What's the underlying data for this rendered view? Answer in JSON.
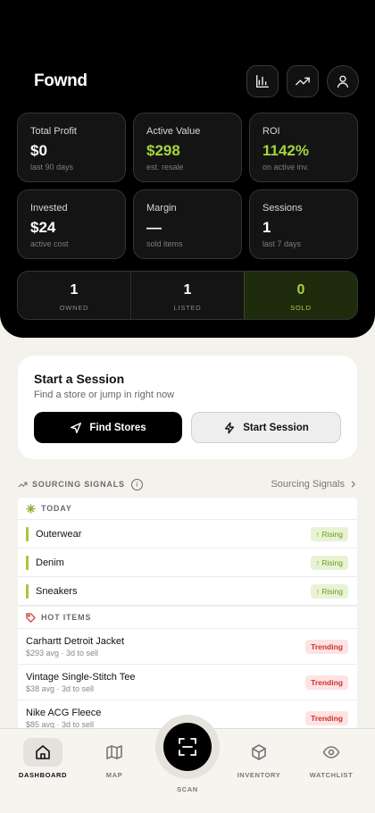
{
  "app": {
    "logo": "Fownd"
  },
  "header_buttons": [
    "chart-bar-icon",
    "trending-up-icon",
    "user-icon"
  ],
  "stats": [
    {
      "label": "Total Profit",
      "value": "$0",
      "sub": "last 90 days"
    },
    {
      "label": "Active Value",
      "value": "$298",
      "sub": "est. resale"
    },
    {
      "label": "ROI",
      "value": "1142%",
      "sub": "on active inv."
    },
    {
      "label": "Invested",
      "value": "$24",
      "sub": "active cost"
    },
    {
      "label": "Margin",
      "value": "—",
      "sub": "sold items"
    },
    {
      "label": "Sessions",
      "value": "1",
      "sub": "last 7 days"
    }
  ],
  "counts": [
    {
      "num": "1",
      "label": "OWNED"
    },
    {
      "num": "1",
      "label": "LISTED"
    },
    {
      "num": "0",
      "label": "SOLD"
    }
  ],
  "session": {
    "title": "Start a Session",
    "desc": "Find a store or jump in right now",
    "find_label": "Find Stores",
    "start_label": "Start Session"
  },
  "signals": {
    "heading": "SOURCING SIGNALS",
    "link": "Sourcing Signals",
    "today_label": "TODAY",
    "today": [
      {
        "name": "Outerwear",
        "tag": "↑ Rising"
      },
      {
        "name": "Denim",
        "tag": "↑ Rising"
      },
      {
        "name": "Sneakers",
        "tag": "↑ Rising"
      }
    ],
    "hot_label": "HOT ITEMS",
    "hot": [
      {
        "name": "Carhartt Detroit Jacket",
        "sub": "$293 avg · 3d to sell",
        "tag": "Trending"
      },
      {
        "name": "Vintage Single-Stitch Tee",
        "sub": "$38 avg · 3d to sell",
        "tag": "Trending"
      },
      {
        "name": "Nike ACG Fleece",
        "sub": "$85 avg · 3d to sell",
        "tag": "Trending"
      }
    ]
  },
  "nav": {
    "dashboard": "DASHBOARD",
    "map": "MAP",
    "scan": "SCAN",
    "inventory": "INVENTORY",
    "watchlist": "WATCHLIST"
  },
  "colors": {
    "accent_green": "#a6d43c",
    "trending_red": "#cf3030"
  }
}
